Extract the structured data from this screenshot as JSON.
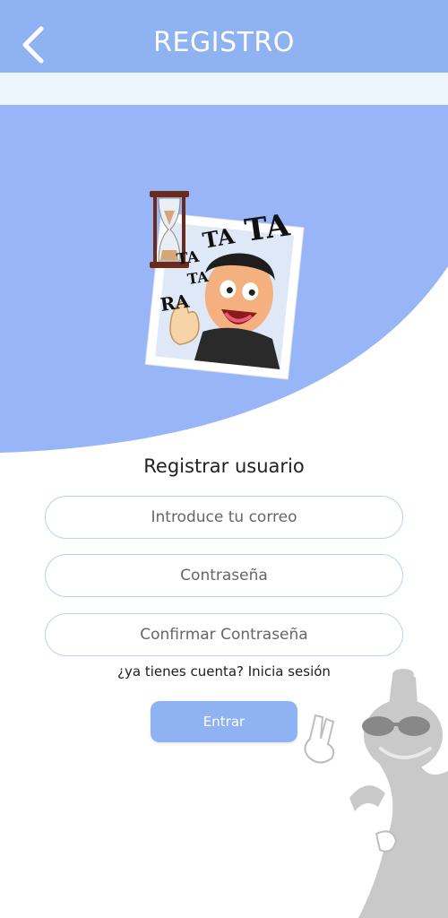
{
  "header": {
    "title": "REGISTRO",
    "back_icon": "chevron-left-icon"
  },
  "hero": {
    "illustration": "cartoon-photo-with-hourglass",
    "sound_text": [
      "TA",
      "TA",
      "TA",
      "TA",
      "RA"
    ]
  },
  "form": {
    "title": "Registrar usuario",
    "email_placeholder": "Introduce tu correo",
    "password_placeholder": "Contraseña",
    "confirm_placeholder": "Confirmar Contraseña",
    "login_link": "¿ya tienes cuenta? Inicia sesión",
    "submit_label": "Entrar"
  },
  "colors": {
    "primary": "#8fb2f2",
    "subbar": "#eef6fd",
    "field_border": "#b9d3ef"
  }
}
